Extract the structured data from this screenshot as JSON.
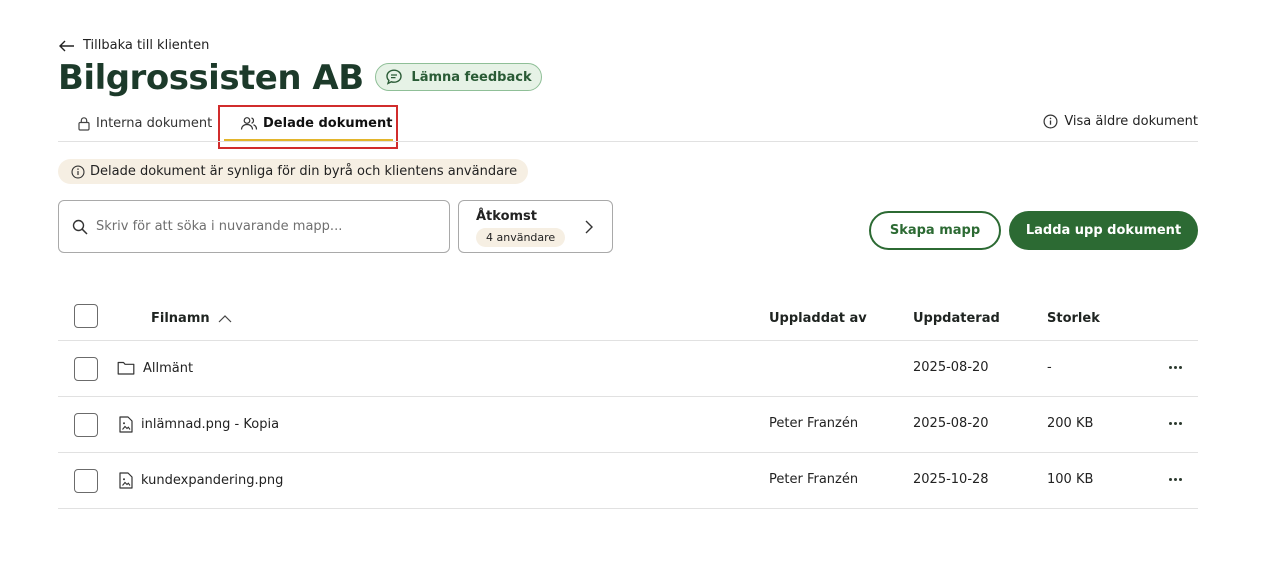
{
  "nav": {
    "back_label": "Tillbaka till klienten"
  },
  "header": {
    "title": "Bilgrossisten AB",
    "feedback_label": "Lämna feedback"
  },
  "tabs": [
    {
      "label": "Interna dokument",
      "active": false
    },
    {
      "label": "Delade dokument",
      "active": true
    }
  ],
  "show_older_label": "Visa äldre dokument",
  "notice": "Delade dokument är synliga för din byrå och klientens användare",
  "search": {
    "placeholder": "Skriv för att söka i nuvarande mapp...",
    "value": ""
  },
  "access": {
    "title": "Åtkomst",
    "badge": "4 användare"
  },
  "actions": {
    "create_folder": "Skapa mapp",
    "upload": "Ladda upp dokument"
  },
  "table": {
    "columns": {
      "name": "Filnamn",
      "uploaded_by": "Uppladdat av",
      "updated": "Uppdaterad",
      "size": "Storlek"
    },
    "rows": [
      {
        "type": "folder",
        "name": "Allmänt",
        "uploaded_by": "",
        "updated": "2025-08-20",
        "size": "-"
      },
      {
        "type": "image",
        "name": "inlämnad.png - Kopia",
        "uploaded_by": "Peter Franzén",
        "updated": "2025-08-20",
        "size": "200 KB"
      },
      {
        "type": "image",
        "name": "kundexpandering.png",
        "uploaded_by": "Peter Franzén",
        "updated": "2025-10-28",
        "size": "100 KB"
      }
    ]
  },
  "colors": {
    "brand_green": "#2c6a33",
    "title_green": "#1c3a2a",
    "highlight_red": "#d12c2c",
    "tab_underline": "#e3b52b",
    "beige": "#f6efe3"
  }
}
